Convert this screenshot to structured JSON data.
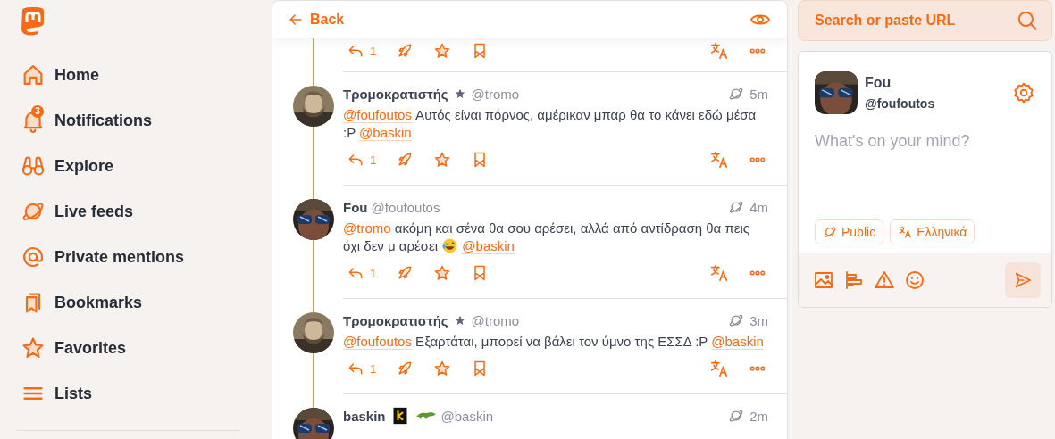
{
  "sidebar": {
    "nav": [
      {
        "label": "Home",
        "kind": "home"
      },
      {
        "label": "Notifications",
        "kind": "bell",
        "badge": "3"
      },
      {
        "label": "Explore",
        "kind": "binoculars"
      },
      {
        "label": "Live feeds",
        "kind": "planet"
      },
      {
        "label": "Private mentions",
        "kind": "at"
      },
      {
        "label": "Bookmarks",
        "kind": "bookmarks"
      },
      {
        "label": "Favorites",
        "kind": "star"
      },
      {
        "label": "Lists",
        "kind": "lists"
      }
    ]
  },
  "header": {
    "back": "Back"
  },
  "thread": {
    "partial_actions": {
      "replies": "1"
    },
    "posts": [
      {
        "name": "Τρομοκρατιστής",
        "badges": [
          {
            "kind": "star"
          }
        ],
        "handle": "@tromo",
        "time": "5m",
        "replies": "1",
        "body": [
          {
            "kind": "mention",
            "text": "@foufoutos"
          },
          {
            "kind": "text",
            "text": " Αυτός είναι πόρνος, αμέρικαν μπαρ θα το κάνει εδώ μέσα :P "
          },
          {
            "kind": "mention",
            "text": "@baskin"
          }
        ]
      },
      {
        "name": "Fou",
        "handle": "@foufoutos",
        "time": "4m",
        "replies": "1",
        "body": [
          {
            "kind": "mention",
            "text": "@tromo"
          },
          {
            "kind": "text",
            "text": " ακόμη και σένα θα σου αρέσει, αλλά από αντίδραση θα πεις όχι δεν μ αρέσει "
          },
          {
            "kind": "emoji"
          },
          {
            "kind": "mention",
            "text": "@baskin"
          }
        ]
      },
      {
        "name": "Τρομοκρατιστής",
        "badges": [
          {
            "kind": "star"
          }
        ],
        "handle": "@tromo",
        "time": "3m",
        "replies": "1",
        "body": [
          {
            "kind": "mention",
            "text": "@foufoutos"
          },
          {
            "kind": "text",
            "text": " Εξαρτάται, μπορεί να βάλει τον ύμνο της ΕΣΣΔ :P "
          },
          {
            "kind": "mention",
            "text": "@baskin"
          }
        ]
      },
      {
        "name": "baskin",
        "badges": [
          {
            "kind": "square"
          },
          {
            "kind": "lizard"
          }
        ],
        "handle": "@baskin",
        "time": "2m"
      }
    ]
  },
  "search": {
    "placeholder": "Search or paste URL"
  },
  "composer": {
    "name": "Fou",
    "handle": "@foufoutos",
    "placeholder": "What's on your mind?",
    "visibility": "Public",
    "language": "Ελληνικά"
  }
}
